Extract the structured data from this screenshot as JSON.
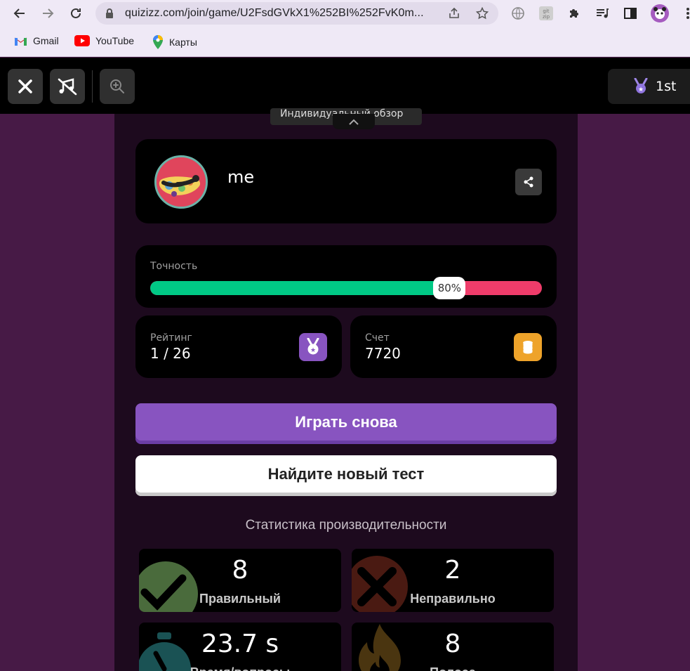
{
  "browser": {
    "url": "quizizz.com/join/game/U2FsdGVkX1%252BI%252FvK0m...",
    "bookmarks": [
      {
        "label": "Gmail",
        "icon": "gmail-icon"
      },
      {
        "label": "YouTube",
        "icon": "youtube-icon"
      },
      {
        "label": "Карты",
        "icon": "maps-icon"
      }
    ]
  },
  "topbar": {
    "rank_label": "1st"
  },
  "peek_label": "Индивидуальный обзор",
  "profile": {
    "name": "me"
  },
  "accuracy": {
    "label": "Точность",
    "value": 0.8,
    "value_text": "80%"
  },
  "rating": {
    "label": "Рейтинг",
    "value": "1 / 26"
  },
  "score": {
    "label": "Счет",
    "value": "7720"
  },
  "buttons": {
    "play_again": "Играть снова",
    "find_new": "Найдите новый тест"
  },
  "performance": {
    "title": "Статистика производительности",
    "tiles": [
      {
        "value": "8",
        "label": "Правильный"
      },
      {
        "value": "2",
        "label": "Неправильно"
      },
      {
        "value": "23.7 s",
        "label": "Время/вопросы"
      },
      {
        "value": "8",
        "label": "Полоса"
      }
    ]
  },
  "colors": {
    "accent_purple": "#8854c0",
    "correct_green": "#00c985",
    "incorrect_red": "#ef3c6a",
    "background": "#471a46"
  }
}
